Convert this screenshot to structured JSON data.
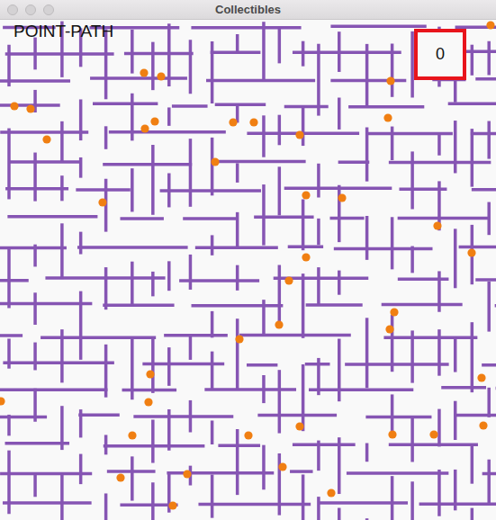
{
  "window": {
    "title": "Collectibles"
  },
  "hud": {
    "label": "POINT-PATH",
    "score": "0"
  }
}
